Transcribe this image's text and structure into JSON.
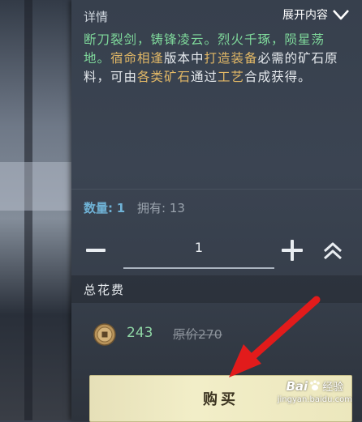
{
  "details": {
    "title": "详情",
    "expand_label": "展开内容",
    "description": [
      {
        "text": "断刀裂剑，铸锋凌云。烈火千琢，陨星荡地。",
        "color": "green"
      },
      {
        "text": "宿命相逢",
        "color": "orange"
      },
      {
        "text": "版本中",
        "color": "white"
      },
      {
        "text": "打造装备",
        "color": "orange"
      },
      {
        "text": "必需的矿石原料，可由",
        "color": "white"
      },
      {
        "text": "各类矿石",
        "color": "orange"
      },
      {
        "text": "通过",
        "color": "white"
      },
      {
        "text": "工艺",
        "color": "orange"
      },
      {
        "text": "合成获得。",
        "color": "white"
      }
    ]
  },
  "quantity": {
    "label": "数量:",
    "value": "1",
    "owned_label": "拥有:",
    "owned_value": "13"
  },
  "stepper": {
    "value": "1"
  },
  "cost": {
    "title": "总花费",
    "price": "243",
    "original_price": "原价270"
  },
  "buy_button": {
    "label": "购买"
  },
  "watermark": {
    "brand": "Bai",
    "paw": "",
    "suffix": "经验",
    "url": "jingyan.baidu.com"
  },
  "colors": {
    "green_text": "#7fd99b",
    "orange_text": "#e2b866",
    "buy_button_bg": "#f2eec8",
    "arrow": "#e21b1b"
  }
}
